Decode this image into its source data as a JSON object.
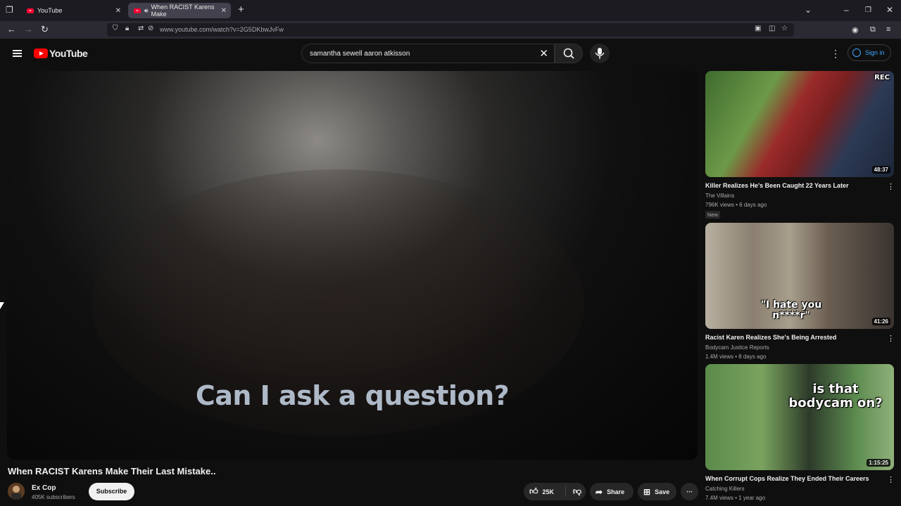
{
  "browser": {
    "tabs": [
      {
        "label": "YouTube"
      },
      {
        "label": "When RACIST Karens Make"
      }
    ],
    "url": "www.youtube.com/watch?v=2G5DKbwJvFw"
  },
  "header": {
    "logo_text": "YouTube",
    "search_query": "samantha sewell aaron atkisson",
    "signin_label": "Sign in"
  },
  "video": {
    "caption": "Can I ask a question?",
    "title": "When RACIST Karens Make Their Last Mistake..",
    "channel": "Ex Cop",
    "subscribers": "405K subscribers",
    "subscribe_label": "Subscribe",
    "likes": "25K",
    "share_label": "Share",
    "save_label": "Save"
  },
  "recommendations": [
    {
      "title": "Killer Realizes He's Been Caught 22 Years Later",
      "channel": "The Villains",
      "meta": "796K views • 6 days ago",
      "badge": "New",
      "duration": "48:37",
      "overlay": "REC"
    },
    {
      "title": "Racist Karen Realizes She's Being Arrested",
      "channel": "Bodycam Justice Reports",
      "meta": "1.4M views • 8 days ago",
      "duration": "41:26",
      "overlay": "\"I hate you n****r\""
    },
    {
      "title": "When Corrupt Cops Realize They Ended Their Careers",
      "channel": "Catching Killers",
      "meta": "7.4M views • 1 year ago",
      "duration": "1:15:25",
      "overlay": "is that bodycam on?"
    }
  ]
}
